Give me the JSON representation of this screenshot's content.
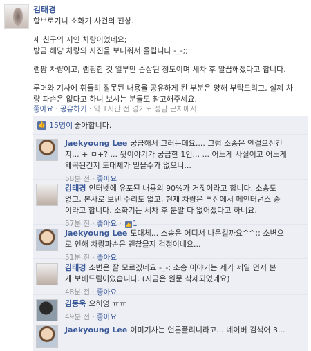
{
  "post": {
    "author": "김태경",
    "lines_a": [
      "함브로기니 소화기 사건의 진상."
    ],
    "lines_b": [
      "제 친구의 지인 차량이었네요;",
      "방금 해당 차량의 사진을 보내줘서 올립니다 -_-;;"
    ],
    "lines_c": [
      "램팡 차량이고, 램핑한 것 일부만 손상된 정도이며 세차 후 말끔해졌다고 합니다."
    ],
    "lines_d": [
      "루머와 기사에 휘둘려 잘못된 내용을 공유하게 된 부분은 양해 부탁드리고, 실제 차",
      "량 파손은 없다고 하니 보시는 분들도 참고해주세요."
    ],
    "meta": {
      "like": "좋아요",
      "sep": " · ",
      "share": "공유하기",
      "time": "약 1시간 전 경기도 성남 근처에서"
    }
  },
  "likes": {
    "count": "15명이",
    "suffix": "좋아합니다."
  },
  "comments": [
    {
      "name": "Jaekyoung Lee",
      "lines": [
        "궁금해서 그러는데요.... 그럼 소송은 안걸으신건",
        "지... + ㅁ+? ... 뒷이야기가 궁금한 1인... ... 어느게 사실이고 어느게",
        "왜곡된건지 도대체가 믿을수가 없으니..."
      ],
      "time": "58분 전",
      "like": "좋아요"
    },
    {
      "name": "김태경",
      "lines": [
        "인터넷에 유포된 내용의 90%가 거짓이라고 합니다. 소송도",
        "없고, 본사로 보낸 수리도 없고, 현재 차량은 부산에서 메인터넌스 중",
        "이라고 합니다. 소화기는 세차 후 분말 다 없어졌다고 하네요."
      ],
      "time": "57분 전",
      "like": "좋아요",
      "likes_count": "1"
    },
    {
      "name": "Jaekyoung Lee",
      "lines": [
        "도대체... 소송은 어디서 나온걸까요^^;; 소변으",
        "로 인해 차량파손은 괜찮을지 걱정이네요..."
      ],
      "time": "51분 전",
      "like": "좋아요"
    },
    {
      "name": "김태경",
      "lines": [
        "소변은 잘 모르겠네요 -_-; 소송 이야기는 제가 제일 먼저 본",
        "게 보배드림이었습니다. (지금은 원문 삭제되었네요)"
      ],
      "time": "48분 전",
      "like": "좋아요"
    },
    {
      "name": "김동욱",
      "lines": [
        "으허엉 ㅠㅠ"
      ],
      "time": "49분 전",
      "like": "좋아요"
    },
    {
      "name": "Jaekyoung Lee",
      "lines": [
        "이미기사는 언론플리니라고... 네이버 검색어 3..."
      ]
    }
  ],
  "colors": {
    "link": "#3b5998",
    "comments_bg": "#edeff4",
    "meta": "#999999"
  }
}
